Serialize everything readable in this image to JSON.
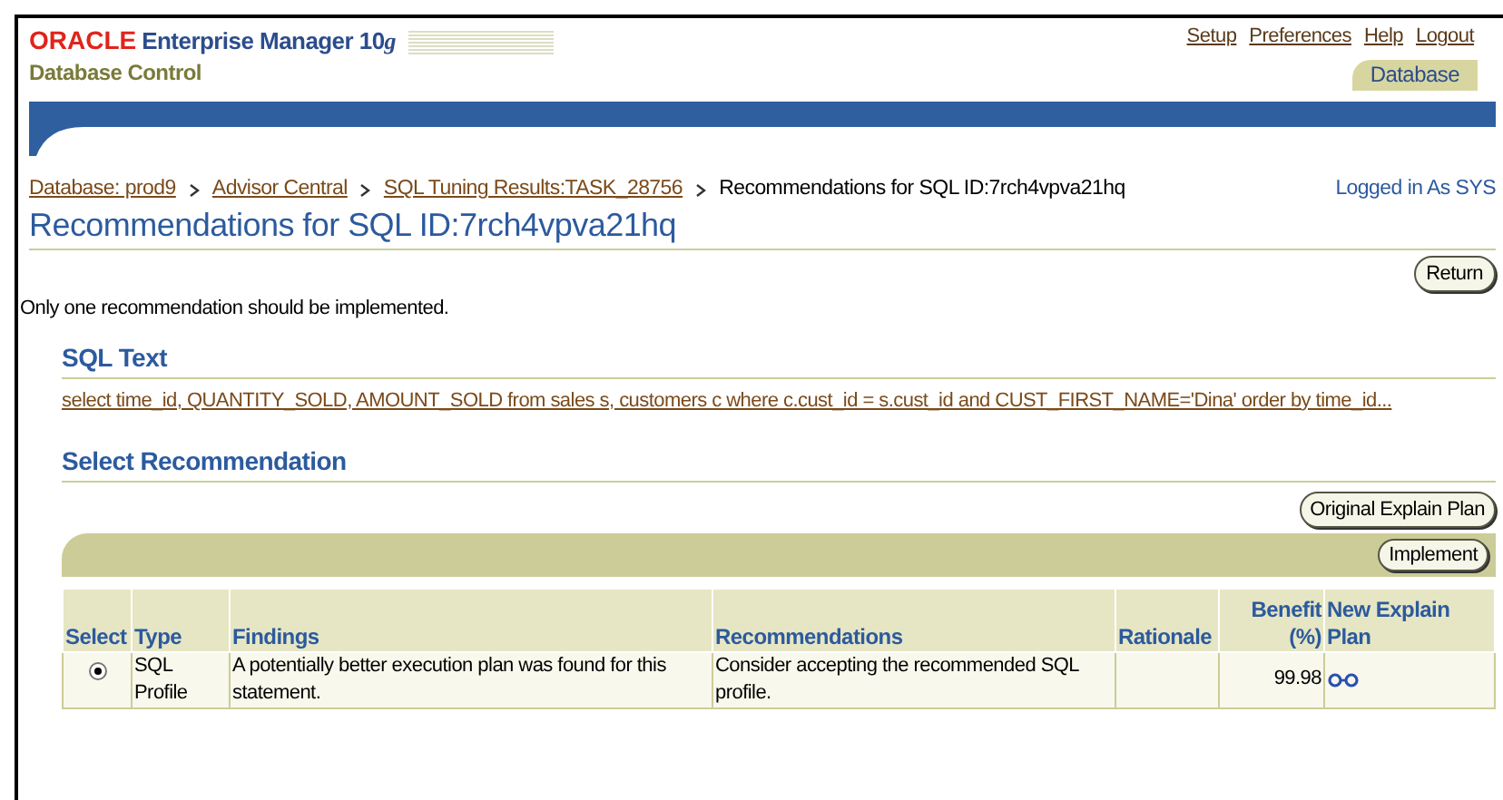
{
  "header": {
    "brand": "ORACLE",
    "product": "Enterprise Manager 10",
    "product_version": "g",
    "subtitle": "Database Control",
    "global_links": [
      "Setup",
      "Preferences",
      "Help",
      "Logout"
    ],
    "tabs": [
      {
        "label": "Database",
        "selected": true
      }
    ]
  },
  "breadcrumb": {
    "links": [
      "Database: prod9",
      "Advisor Central",
      "SQL Tuning Results:TASK_28756"
    ],
    "current": "Recommendations for SQL ID:7rch4vpva21hq"
  },
  "login_status": "Logged in As SYS",
  "page_title": "Recommendations for SQL ID:7rch4vpva21hq",
  "return_button": "Return",
  "note": "Only one recommendation should be implemented.",
  "sql_text": {
    "heading": "SQL Text",
    "text": "select time_id, QUANTITY_SOLD, AMOUNT_SOLD from sales s, customers c where c.cust_id = s.cust_id and CUST_FIRST_NAME='Dina' order by time_id..."
  },
  "select_recommendation": {
    "heading": "Select Recommendation",
    "explain_button": "Original Explain Plan",
    "implement_button": "Implement",
    "table": {
      "columns": [
        "Select",
        "Type",
        "Findings",
        "Recommendations",
        "Rationale",
        "Benefit (%)",
        "New Explain Plan"
      ],
      "rows": [
        {
          "selected": true,
          "type": "SQL Profile",
          "findings": "A potentially better execution plan was found for this statement.",
          "recommendations": "Consider accepting the recommended SQL profile.",
          "rationale": "",
          "benefit": "99.98"
        }
      ]
    }
  }
}
